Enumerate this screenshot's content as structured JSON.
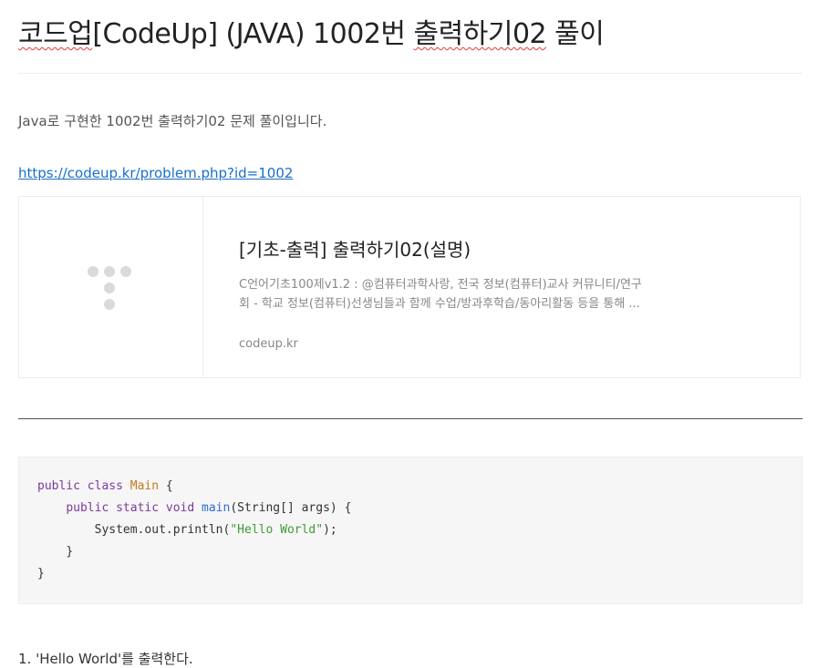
{
  "post": {
    "title_prefix": "코드업",
    "title_mid": "[CodeUp] (JAVA) 1002번 ",
    "title_underlined": "출력하기02",
    "title_suffix": " 풀이",
    "intro": "Java로 구현한 1002번 출력하기02 문제 풀이입니다.",
    "link": "https://codeup.kr/problem.php?id=1002"
  },
  "link_card": {
    "title": "[기초-출력] 출력하기02(설명)",
    "description_line1": "C언어기초100제v1.2 : @컴퓨터과학사랑, 전국 정보(컴퓨터)교사 커뮤니티/연구",
    "description_line2": "회 - 학교 정보(컴퓨터)선생님들과 함께 수업/방과후학습/동아리활동 등을 통해 ...",
    "host": "codeup.kr",
    "thumbnail_icon": "placeholder-dots-icon"
  },
  "code": {
    "kw_public_class": "public class",
    "class_name": "Main",
    "open_brace": " {",
    "kw_public_static_void": "public static void",
    "method_name": "main",
    "params": "(String[] args) {",
    "print_call": "System.out.println(",
    "string_literal": "\"Hello World\"",
    "print_end": ");",
    "close_inner": "}",
    "close_outer": "}"
  },
  "list": {
    "item1": "1. 'Hello World'를 출력한다."
  },
  "colors": {
    "link": "#1a6fc9",
    "keyword": "#7b3a9b",
    "class_name": "#c07b18",
    "method": "#2f6bd0",
    "string": "#3e9b33"
  }
}
